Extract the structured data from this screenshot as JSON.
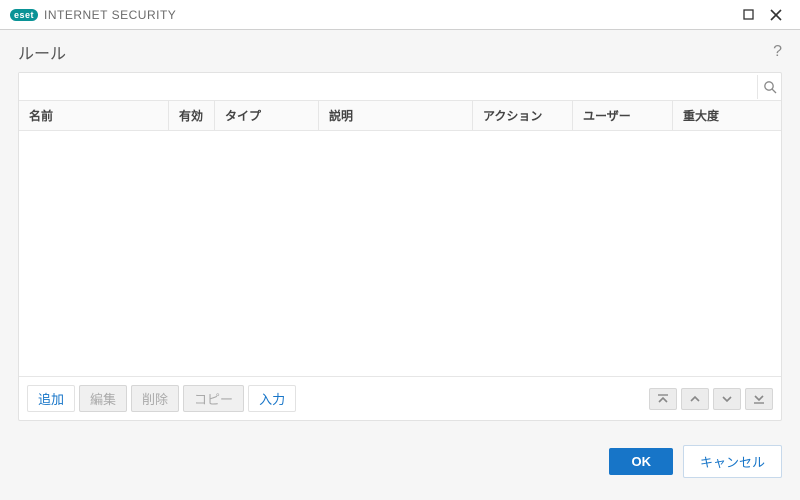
{
  "titlebar": {
    "brand": "eset",
    "app": "INTERNET SECURITY"
  },
  "subtitle": "ルール",
  "search_placeholder": "",
  "columns": {
    "name": "名前",
    "valid": "有効",
    "type": "タイプ",
    "desc": "説明",
    "action": "アクション",
    "user": "ユーザー",
    "priority": "重大度"
  },
  "actions": {
    "add": "追加",
    "edit": "編集",
    "delete": "削除",
    "copy": "コピー",
    "input": "入力"
  },
  "footer": {
    "ok": "OK",
    "cancel": "キャンセル"
  }
}
